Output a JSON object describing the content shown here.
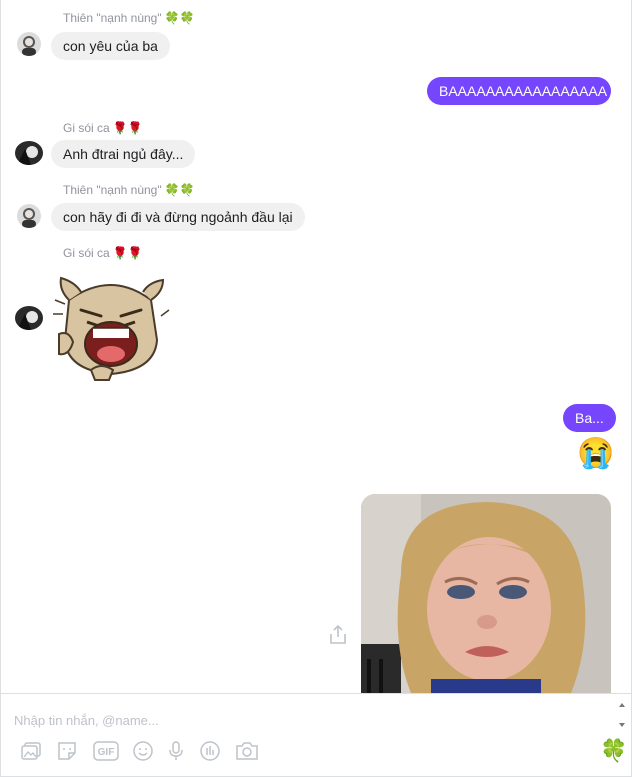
{
  "thread": {
    "messages": [
      {
        "sender": "Thiên \"nạnh nùng\"",
        "sender_emoji": "🍀🍀",
        "text": "con yêu của ba",
        "direction": "in"
      },
      {
        "text": "BAAAAAAAAAAAAAAAAA",
        "direction": "out"
      },
      {
        "sender": "Gi sói ca",
        "sender_emoji": "🌹🌹",
        "text": "Anh đtrai ngủ đây...",
        "direction": "in"
      },
      {
        "sender": "Thiên \"nạnh nùng\"",
        "sender_emoji": "🍀🍀",
        "text": "con hãy đi đi và đừng ngoảnh đầu lại",
        "direction": "in"
      },
      {
        "sender": "Gi sói ca",
        "sender_emoji": "🌹🌹",
        "sticker": "crying-bear-sticker",
        "direction": "in"
      },
      {
        "text": "Ba...",
        "direction": "out"
      },
      {
        "emoji": "😭",
        "direction": "out"
      },
      {
        "photo": "crying-child-photo",
        "direction": "out"
      }
    ]
  },
  "composer": {
    "placeholder": "Nhập tin nhắn, @name...",
    "value": "",
    "tools": [
      "image-icon",
      "sticker-icon",
      "gif-icon",
      "emoji-icon",
      "microphone-icon",
      "poll-icon",
      "camera-icon"
    ],
    "gif_label": "GIF",
    "like_emoji": "🍀"
  },
  "colors": {
    "outgoing_bubble": "#7646ff",
    "incoming_bubble": "#f1f0f0",
    "meta_text": "#90949c"
  }
}
